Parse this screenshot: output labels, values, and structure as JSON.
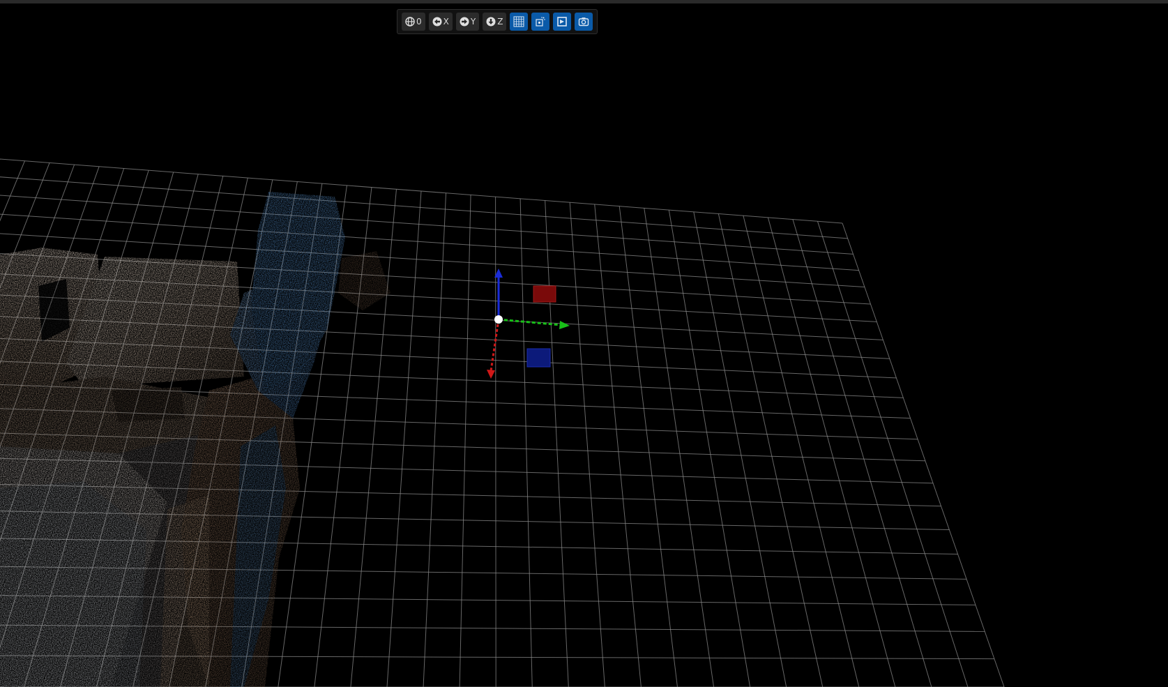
{
  "toolbar": {
    "buttons": [
      {
        "id": "view-origin",
        "label": "0",
        "icon": "globe-icon"
      },
      {
        "id": "view-x",
        "label": "X",
        "icon": "arrow-circle-left-icon"
      },
      {
        "id": "view-y",
        "label": "Y",
        "icon": "arrow-circle-right-icon"
      },
      {
        "id": "view-z",
        "label": "Z",
        "icon": "arrow-circle-down-icon"
      },
      {
        "id": "toggle-grid",
        "icon": "grid-pattern-icon"
      },
      {
        "id": "toggle-points",
        "icon": "points-cube-icon"
      },
      {
        "id": "toggle-bbox",
        "icon": "selection-box-icon"
      },
      {
        "id": "screenshot",
        "icon": "camera-icon"
      }
    ]
  },
  "colors": {
    "background": "#000000",
    "grid": "#8a8a8a",
    "axis_x": "#d01818",
    "axis_y": "#18c018",
    "axis_z": "#1a2cd8",
    "toolbar_active": "#0a5aa8",
    "toolbar_button": "#2b2b2b"
  }
}
